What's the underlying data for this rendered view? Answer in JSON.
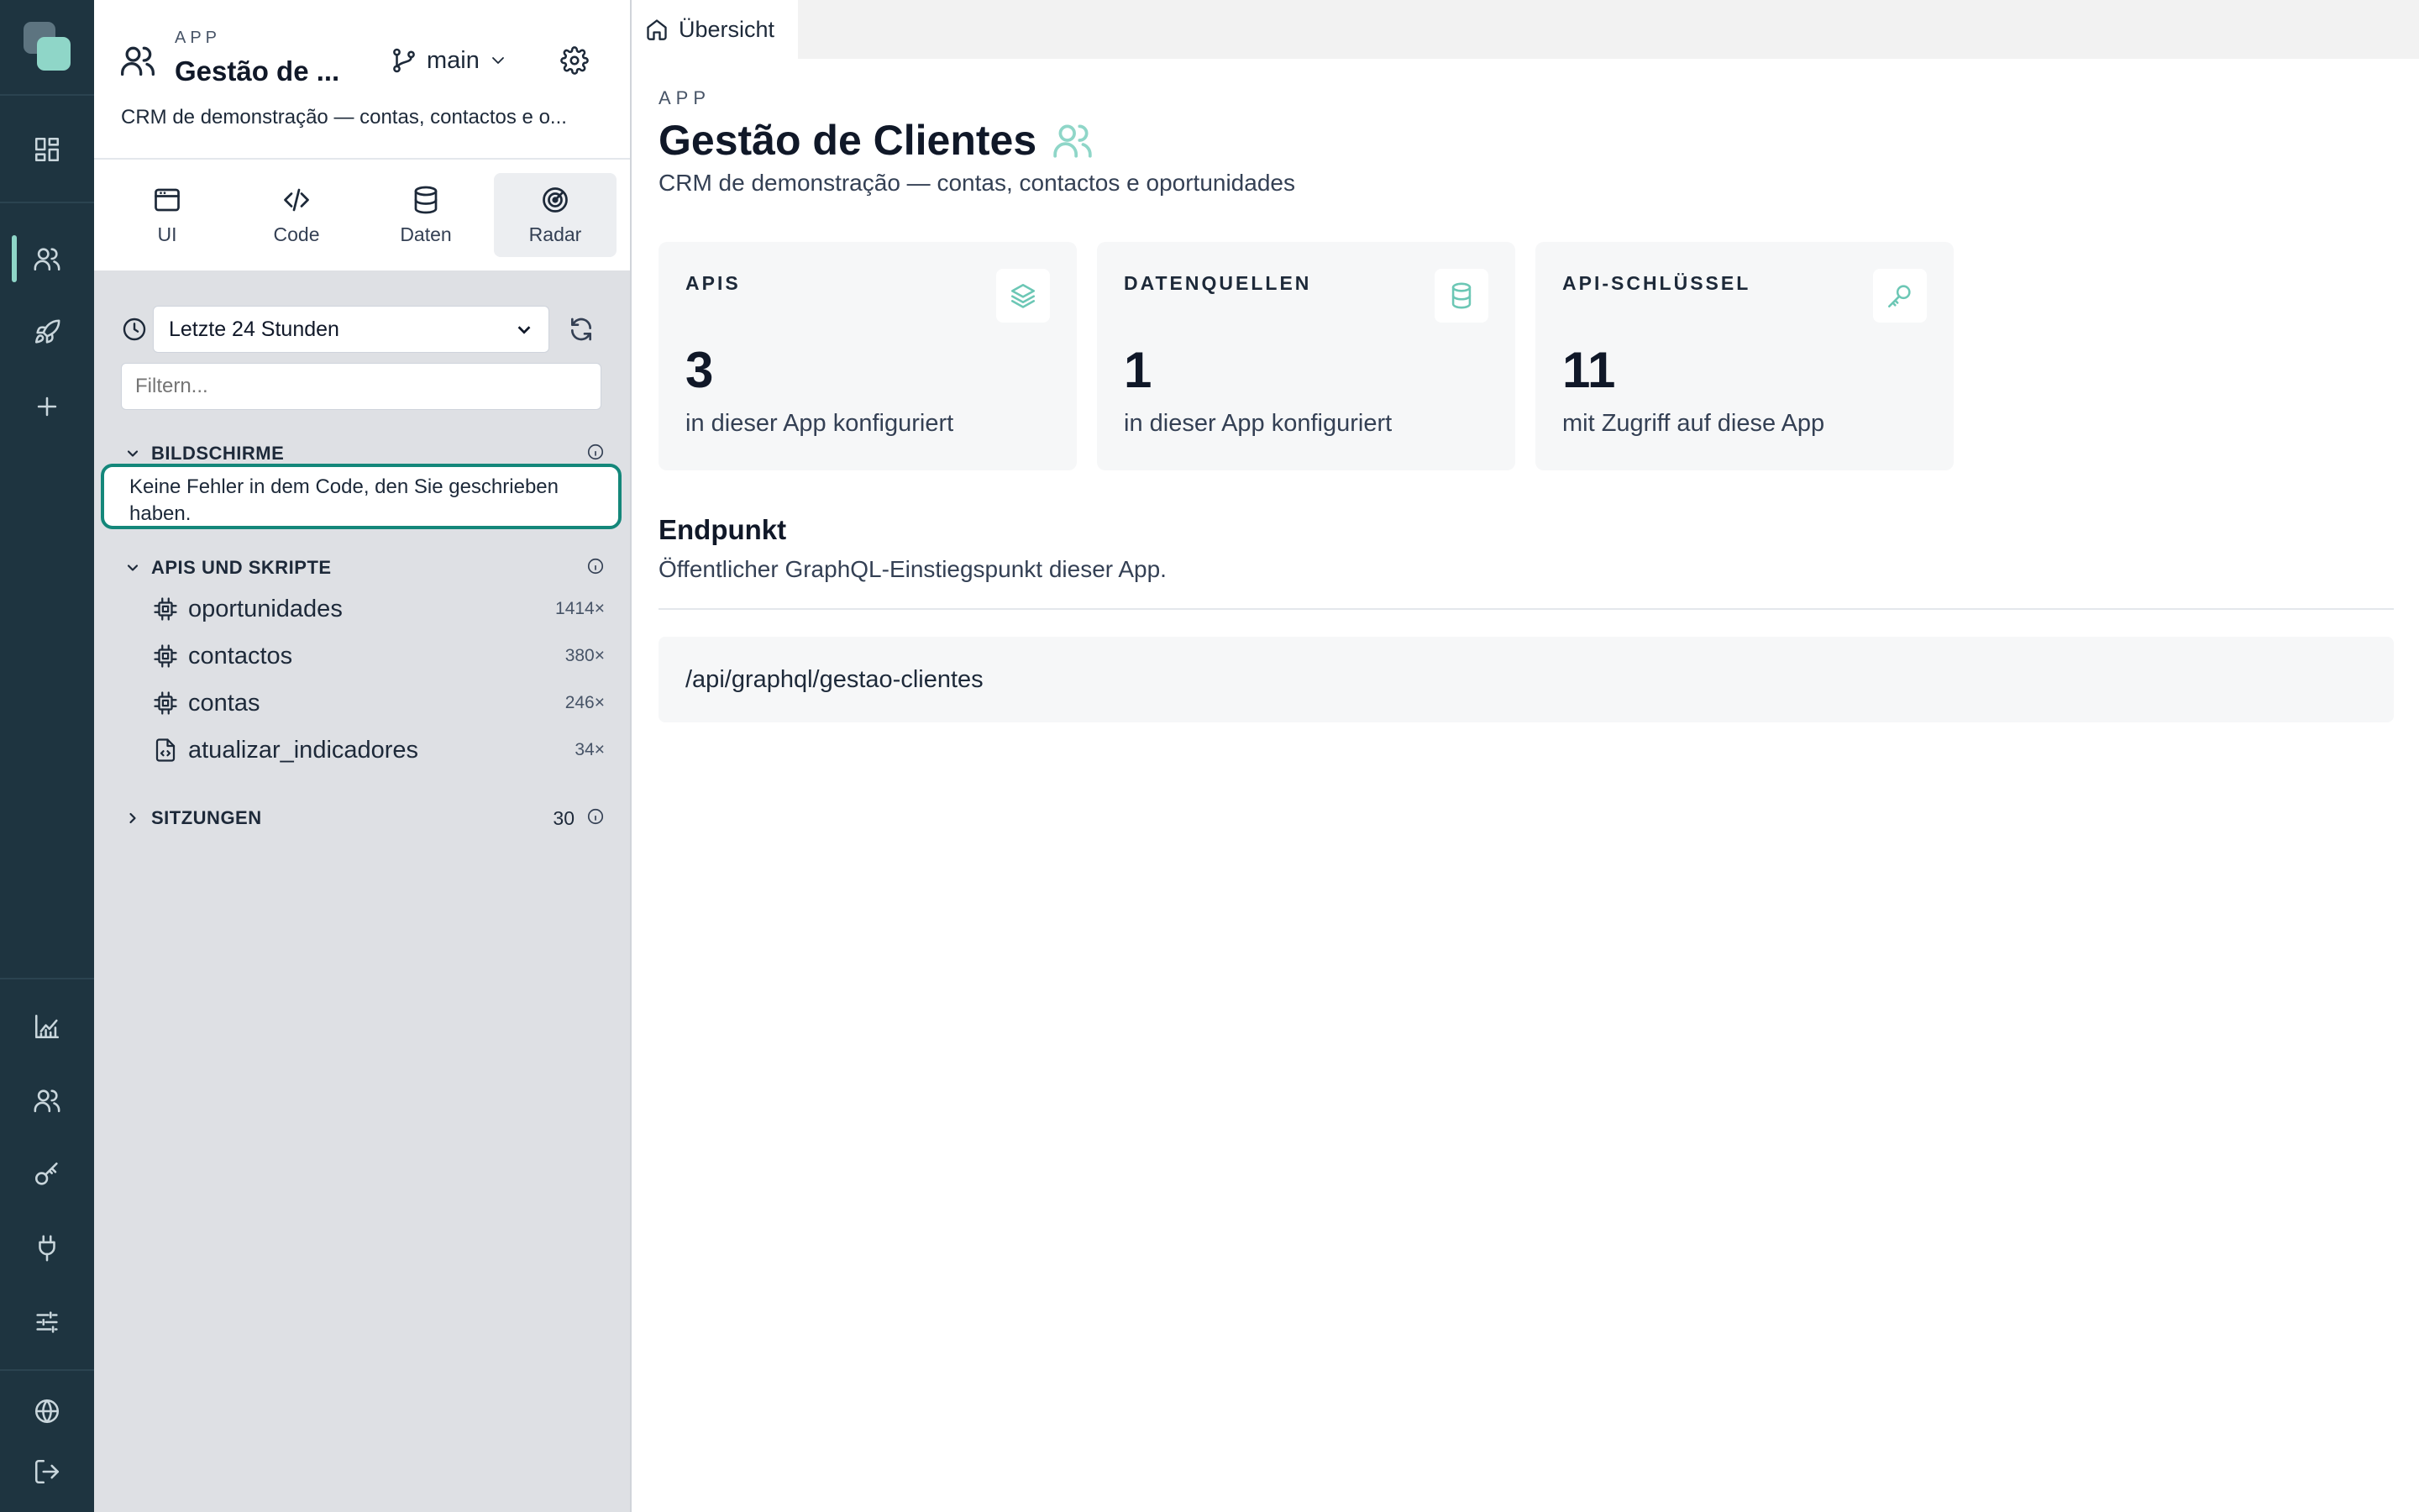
{
  "panel": {
    "kicker": "APP",
    "title": "Gestão de ...",
    "branch": "main",
    "description": "CRM de demonstração — contas, contactos e o...",
    "tabs": [
      {
        "label": "UI",
        "icon": "window-icon"
      },
      {
        "label": "Code",
        "icon": "code-icon"
      },
      {
        "label": "Daten",
        "icon": "database-icon"
      },
      {
        "label": "Radar",
        "icon": "radar-icon"
      }
    ],
    "time_range": "Letzte 24 Stunden",
    "filter_placeholder": "Filtern...",
    "screens_label": "BILDSCHIRME",
    "screens_empty": "Keine Fehler in dem Code, den Sie geschrieben haben.",
    "apis_label": "APIS UND SKRIPTE",
    "apis": [
      {
        "name": "oportunidades",
        "count": "1414×",
        "icon": "chip-icon"
      },
      {
        "name": "contactos",
        "count": "380×",
        "icon": "chip-icon"
      },
      {
        "name": "contas",
        "count": "246×",
        "icon": "chip-icon"
      },
      {
        "name": "atualizar_indicadores",
        "count": "34×",
        "icon": "script-file-icon"
      }
    ],
    "sessions_label": "SITZUNGEN",
    "sessions_count": "30"
  },
  "main": {
    "tab_label": "Übersicht",
    "kicker": "APP",
    "title": "Gestão de Clientes",
    "subtitle": "CRM de demonstração — contas, contactos e oportunidades",
    "cards": [
      {
        "label": "APIS",
        "value": "3",
        "desc": "in dieser App konfiguriert",
        "icon": "layers-icon"
      },
      {
        "label": "DATENQUELLEN",
        "value": "1",
        "desc": "in dieser App konfiguriert",
        "icon": "database-icon"
      },
      {
        "label": "API-SCHLÜSSEL",
        "value": "11",
        "desc": "mit Zugriff auf diese App",
        "icon": "key-icon"
      }
    ],
    "endpoint_title": "Endpunkt",
    "endpoint_sub": "Öffentlicher GraphQL-Einstiegspunkt dieser App.",
    "endpoint_url": "/api/graphql/gestao-clientes"
  },
  "colors": {
    "rail": "#1e3440",
    "accent": "#8fd6c8",
    "focus": "#14877a"
  }
}
